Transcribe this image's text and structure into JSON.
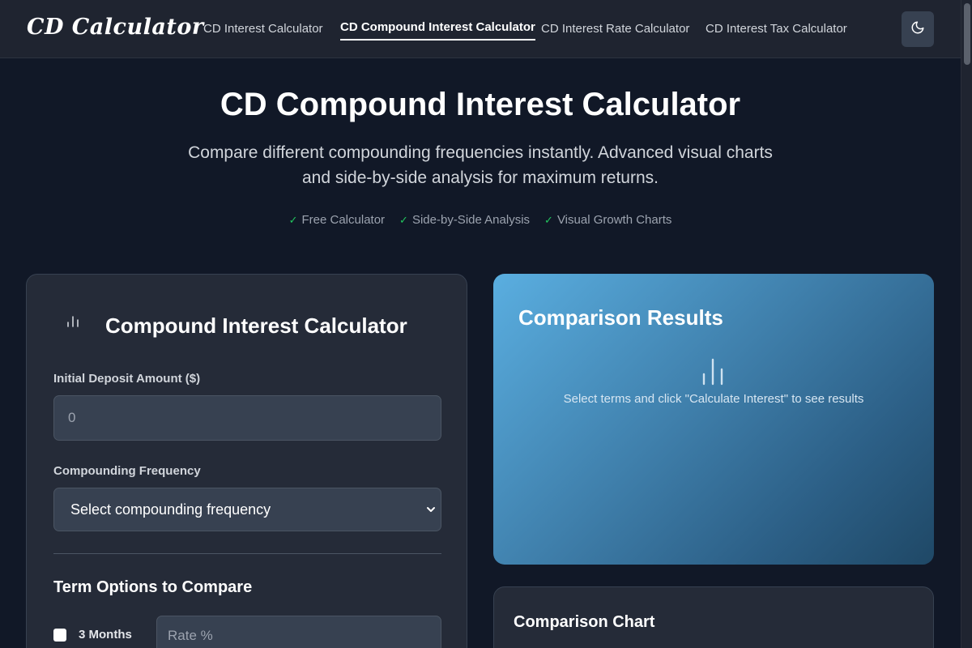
{
  "header": {
    "logo": "CD Calculator",
    "nav": [
      {
        "label": "CD Interest Calculator",
        "active": false
      },
      {
        "label": "CD Compound Interest Calculator",
        "active": true
      },
      {
        "label": "CD Interest Rate Calculator",
        "active": false
      },
      {
        "label": "CD Interest Tax Calculator",
        "active": false
      }
    ],
    "theme_toggle_icon": "moon-icon"
  },
  "hero": {
    "title": "CD Compound Interest Calculator",
    "subtitle": "Compare different compounding frequencies instantly. Advanced visual charts and side-by-side analysis for maximum returns.",
    "features": [
      "Free Calculator",
      "Side-by-Side Analysis",
      "Visual Growth Charts"
    ]
  },
  "calculator": {
    "title": "Compound Interest Calculator",
    "icon": "bar-chart-icon",
    "deposit_label": "Initial Deposit Amount ($)",
    "deposit_value": "0",
    "frequency_label": "Compounding Frequency",
    "frequency_selected": "Select compounding frequency",
    "terms_title": "Term Options to Compare",
    "terms": [
      {
        "label": "3 Months",
        "checked": false,
        "rate_placeholder": "Rate %"
      }
    ]
  },
  "results": {
    "title": "Comparison Results",
    "icon": "bar-chart-icon",
    "empty_message": "Select terms and click \"Calculate Interest\" to see results"
  },
  "chart_section": {
    "title": "Comparison Chart"
  },
  "colors": {
    "background": "#111827",
    "header": "#1f2430",
    "card": "#252b38",
    "results_gradient_start": "#5aaee0",
    "results_gradient_end": "#1f4866",
    "check_green": "#22c55e"
  }
}
